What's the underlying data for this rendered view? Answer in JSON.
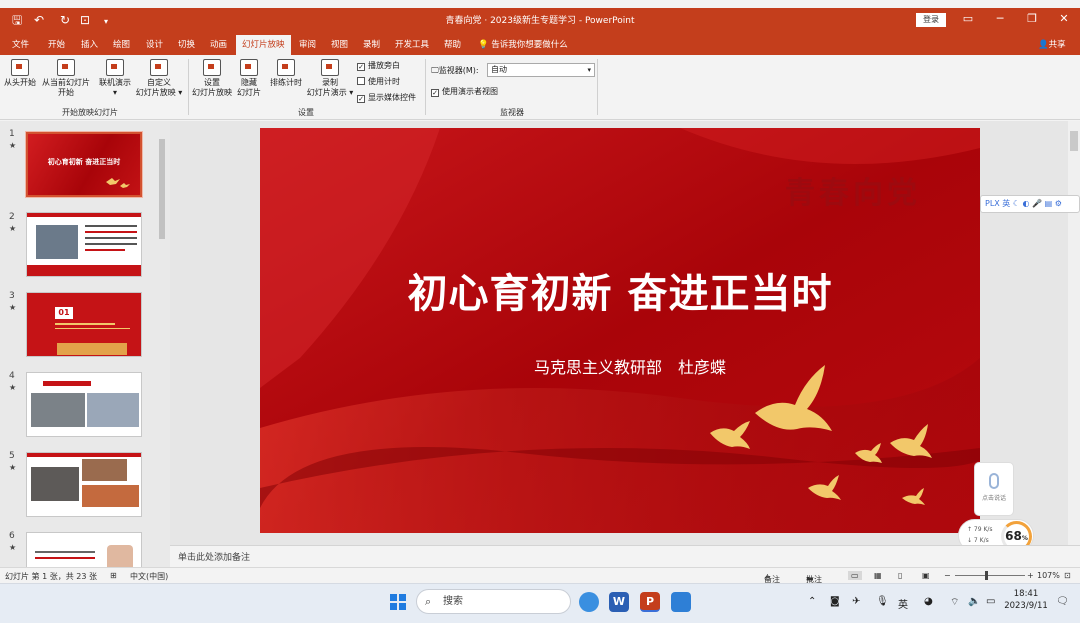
{
  "window": {
    "doc_title": "青春向党 · 2023级新生专题学习 - PowerPoint",
    "signin_label": "登录",
    "quick_access": [
      "save-icon",
      "undo-icon",
      "redo-icon",
      "present-icon",
      "more-icon"
    ]
  },
  "ribbon": {
    "tabs": [
      "文件",
      "开始",
      "插入",
      "绘图",
      "设计",
      "切换",
      "动画",
      "幻灯片放映",
      "审阅",
      "视图",
      "录制",
      "开发工具",
      "帮助"
    ],
    "active_tab": "幻灯片放映",
    "tell_me": "告诉我你想要做什么",
    "share": "共享",
    "start_group": {
      "label": "开始放映幻灯片",
      "buttons": [
        {
          "line1": "从头开始",
          "line2": ""
        },
        {
          "line1": "从当前幻灯片",
          "line2": "开始"
        },
        {
          "line1": "联机演示",
          "line2": "▾"
        },
        {
          "line1": "自定义",
          "line2": "幻灯片放映 ▾"
        }
      ]
    },
    "setup_group": {
      "label": "设置",
      "buttons": [
        {
          "line1": "设置",
          "line2": "幻灯片放映"
        },
        {
          "line1": "隐藏",
          "line2": "幻灯片"
        },
        {
          "line1": "排练计时",
          "line2": ""
        },
        {
          "line1": "录制",
          "line2": "幻灯片演示 ▾"
        }
      ],
      "checkboxes": [
        {
          "label": "播放旁白",
          "checked": true
        },
        {
          "label": "使用计时",
          "checked": false
        },
        {
          "label": "显示媒体控件",
          "checked": true
        }
      ]
    },
    "monitors_group": {
      "label": "监视器",
      "monitor_label": "监视器(M):",
      "monitor_value": "自动",
      "presenter_view_label": "使用演示者视图",
      "presenter_view_checked": true
    }
  },
  "thumbnails": [
    {
      "num": "1",
      "star": "★",
      "title": "初心育初新 奋进正当时"
    },
    {
      "num": "2",
      "star": "★",
      "title": ""
    },
    {
      "num": "3",
      "star": "★",
      "title": "01"
    },
    {
      "num": "4",
      "star": "★",
      "title": ""
    },
    {
      "num": "5",
      "star": "★",
      "title": ""
    },
    {
      "num": "6",
      "star": "★",
      "title": ""
    }
  ],
  "slide": {
    "title": "初心育初新 奋进正当时",
    "subtitle": "马克思主义教研部　杜彦蝶",
    "watermark": "青春向党"
  },
  "floating_toolbar": {
    "text": "PLX 英 ☾ ◐ 🎤 ▤ ⚙"
  },
  "voice_widget": {
    "label": "点击说话"
  },
  "network_widget": {
    "up": "↑ 79 K/s",
    "down": "↓ 7 K/s",
    "percent": "68",
    "percent_unit": "%"
  },
  "notes_placeholder": "单击此处添加备注",
  "statusbar": {
    "slide_info": "幻灯片 第 1 张，共 23 张",
    "language": "中文(中国)",
    "notes": "备注",
    "comments": "批注",
    "zoom": "107%"
  },
  "taskbar": {
    "search_placeholder": "搜索",
    "ime": "英",
    "time": "18:41",
    "date": "2023/9/11"
  },
  "colors": {
    "accent": "#c43e1c",
    "slide_red": "#b3050a",
    "dove_gold": "#f2c86a"
  }
}
